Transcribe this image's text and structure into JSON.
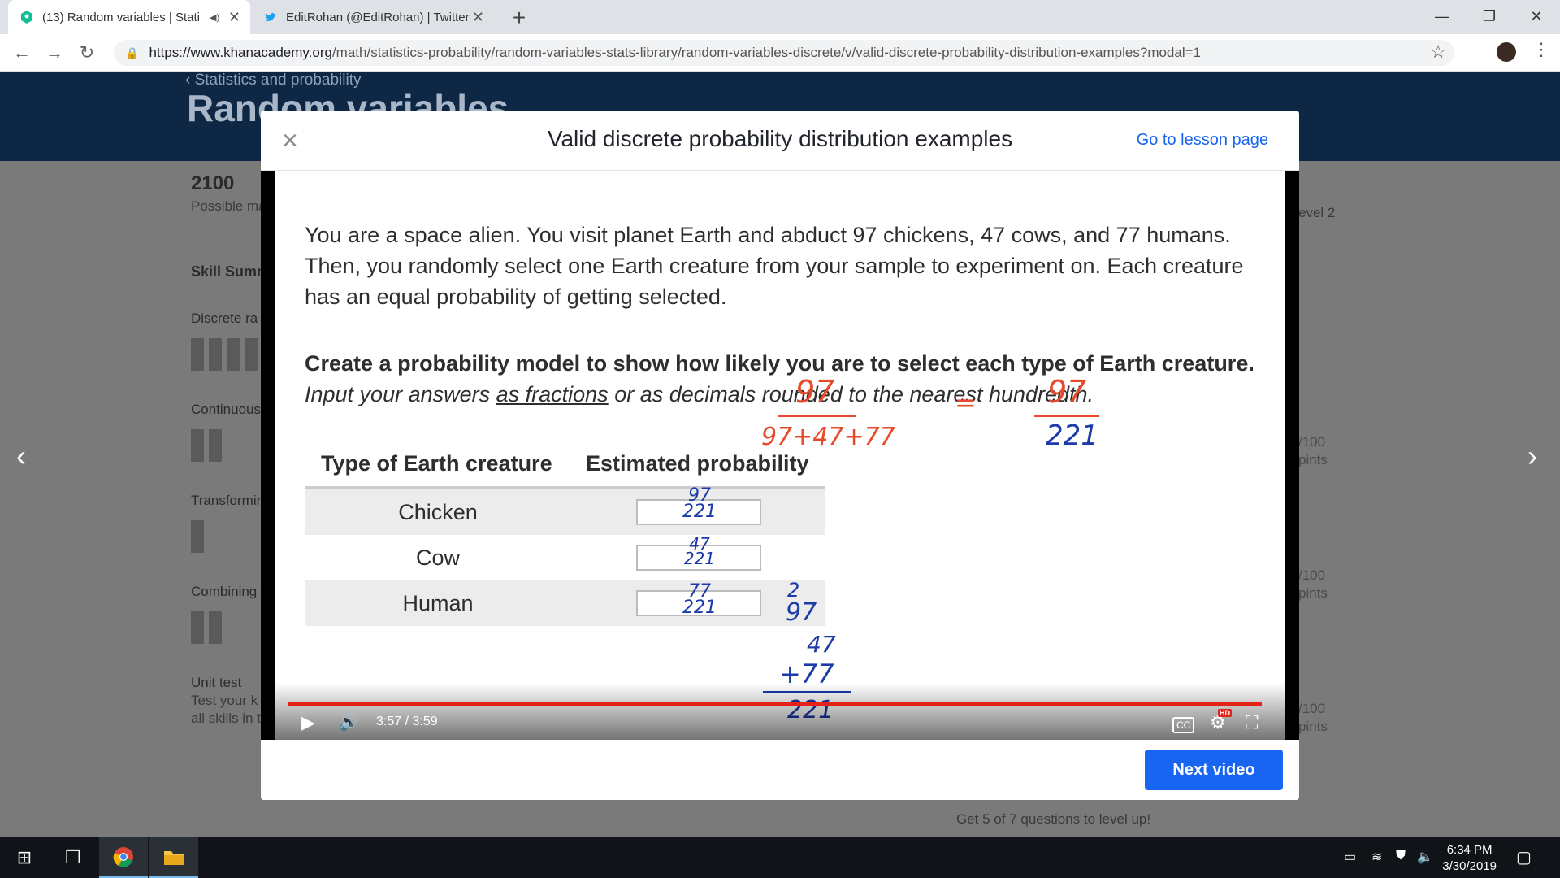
{
  "browser": {
    "tabs": [
      {
        "title": "(13) Random variables | Stati",
        "audio": "◀)",
        "close": "✕"
      },
      {
        "title": "EditRohan (@EditRohan) | Twitter",
        "close": "✕"
      }
    ],
    "new_tab": "+",
    "window_controls": {
      "minimize": "—",
      "restore": "❐",
      "close": "✕"
    },
    "nav": {
      "back": "←",
      "forward": "→",
      "reload": "↻"
    },
    "url_host": "https://www.khanacademy.org",
    "url_path": "/math/statistics-probability/random-variables-stats-library/random-variables-discrete/v/valid-discrete-probability-distribution-examples?modal=1",
    "bookmark_icon": "☆",
    "menu_icon": "⋮"
  },
  "background_page": {
    "breadcrumb": "‹ Statistics and probability",
    "title": "Random variables",
    "mastery_points": "2100",
    "mastery_label": "Possible ma",
    "skill_summary": "Skill Sumn",
    "items": [
      "Discrete ra",
      "Continuous",
      "Transformin",
      "Combining",
      "Unit test"
    ],
    "unit_test_desc_1": "Test your k",
    "unit_test_desc_2": "all skills in t",
    "right_level": "evel 2",
    "right_points": [
      "/100",
      "pints",
      "/100",
      "pints",
      "/100",
      "pints"
    ],
    "level_up": "Get 5 of 7 questions to level up!"
  },
  "modal": {
    "title": "Valid discrete probability distribution examples",
    "close_icon": "×",
    "lesson_link": "Go to lesson page",
    "next_button": "Next video"
  },
  "video": {
    "problem_text": "You are a space alien. You visit planet Earth and abduct 97 chickens, 47 cows, and 77 humans. Then, you randomly select one Earth creature from your sample to experiment on. Each creature has an equal probability of getting selected.",
    "instruction_bold": "Create a probability model to show how likely you are to select each type of Earth creature.",
    "instruction_italic_pre": "Input your answers ",
    "instruction_italic_link": "as fractions",
    "instruction_italic_post": " or as decimals rounded to the nearest hundredth.",
    "table": {
      "headers": [
        "Type of Earth creature",
        "Estimated probability"
      ],
      "rows": [
        {
          "label": "Chicken",
          "num": "97",
          "den": "221"
        },
        {
          "label": "Cow",
          "num": "47",
          "den": "221"
        },
        {
          "label": "Human",
          "num": "77",
          "den": "221"
        }
      ]
    },
    "handwriting": {
      "red_num": "97",
      "red_den": "97+47+77",
      "equals": "=",
      "blue_num": "97",
      "blue_den": "221",
      "sum_carry": "2",
      "sum_lines": [
        "97",
        "47",
        "+77"
      ],
      "sum_result": "221"
    },
    "time": "3:57 / 3:59",
    "progress": 0.99,
    "play_icon": "▶",
    "volume_icon": "🔊",
    "cc_label": "CC",
    "hd_label": "HD",
    "fullscreen_icon": "⛶"
  },
  "taskbar": {
    "time": "6:34 PM",
    "date": "3/30/2019"
  }
}
